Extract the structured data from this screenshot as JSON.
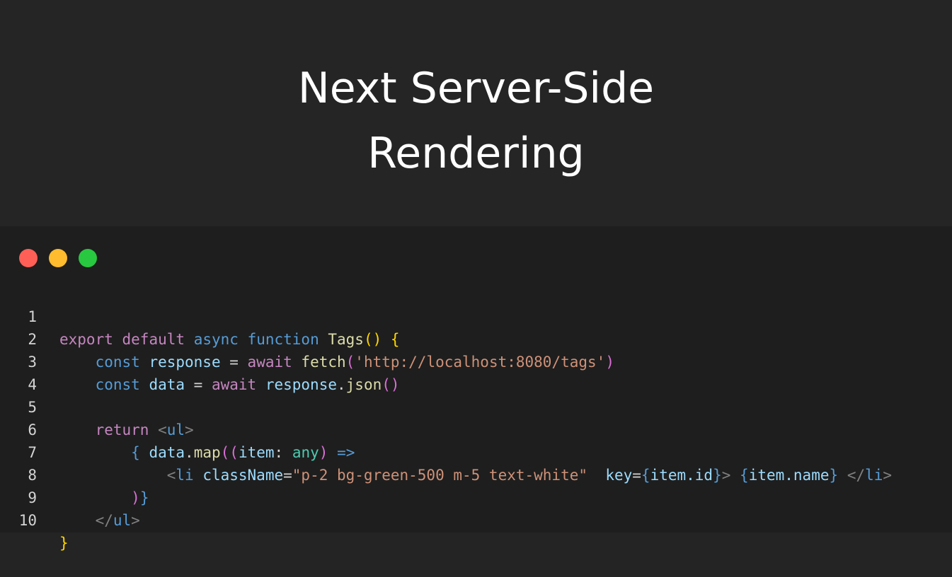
{
  "slide": {
    "title_line_1": "Next Server-Side",
    "title_line_2": "Rendering"
  },
  "window": {
    "dots": [
      {
        "name": "close",
        "color": "#ff5f57"
      },
      {
        "name": "minimize",
        "color": "#febc2e"
      },
      {
        "name": "maximize",
        "color": "#28c840"
      }
    ]
  },
  "code": {
    "line_numbers": [
      "1",
      "2",
      "3",
      "4",
      "5",
      "6",
      "7",
      "8",
      "9",
      "10"
    ],
    "l1": {
      "t1": "export",
      "t2": " ",
      "t3": "default",
      "t4": " ",
      "t5": "async",
      "t6": " ",
      "t7": "function",
      "t8": " ",
      "t9": "Tags",
      "t10": "()",
      "t11": " {"
    },
    "l2": {
      "indent": "    ",
      "t1": "const",
      "t2": " ",
      "t3": "response",
      "t4": " = ",
      "t5": "await",
      "t6": " ",
      "t7": "fetch",
      "t8": "(",
      "t9": "'http://localhost:8080/tags'",
      "t10": ")"
    },
    "l3": {
      "indent": "    ",
      "t1": "const",
      "t2": " ",
      "t3": "data",
      "t4": " = ",
      "t5": "await",
      "t6": " ",
      "t7": "response",
      "t8": ".",
      "t9": "json",
      "t10": "()"
    },
    "l5": {
      "indent": "    ",
      "t1": "return",
      "t2": " ",
      "t3": "<",
      "t4": "ul",
      "t5": ">"
    },
    "l6": {
      "indent": "        ",
      "t1": "{",
      "t2": " ",
      "t3": "data",
      "t4": ".",
      "t5": "map",
      "t6": "((",
      "t7": "item",
      "t8": ": ",
      "t9": "any",
      "t10": ")",
      "t11": " ",
      "t12": "=>"
    },
    "l7": {
      "indent": "            ",
      "t1": "<",
      "t2": "li",
      "t3": " ",
      "t4": "className",
      "t5": "=",
      "t6": "\"p-2 bg-green-500 m-5 text-white\"",
      "t7": "  ",
      "t8": "key",
      "t9": "=",
      "t10": "{",
      "t11": "item.id",
      "t12": "}",
      "t13": ">",
      "t14": " ",
      "t15": "{",
      "t16": "item.name",
      "t17": "}",
      "t18": " ",
      "t19": "</",
      "t20": "li",
      "t21": ">"
    },
    "l8": {
      "indent": "        ",
      "t1": ")",
      "t2": "}"
    },
    "l9": {
      "indent": "    ",
      "t1": "</",
      "t2": "ul",
      "t3": ">"
    },
    "l10": {
      "t1": "}"
    }
  }
}
